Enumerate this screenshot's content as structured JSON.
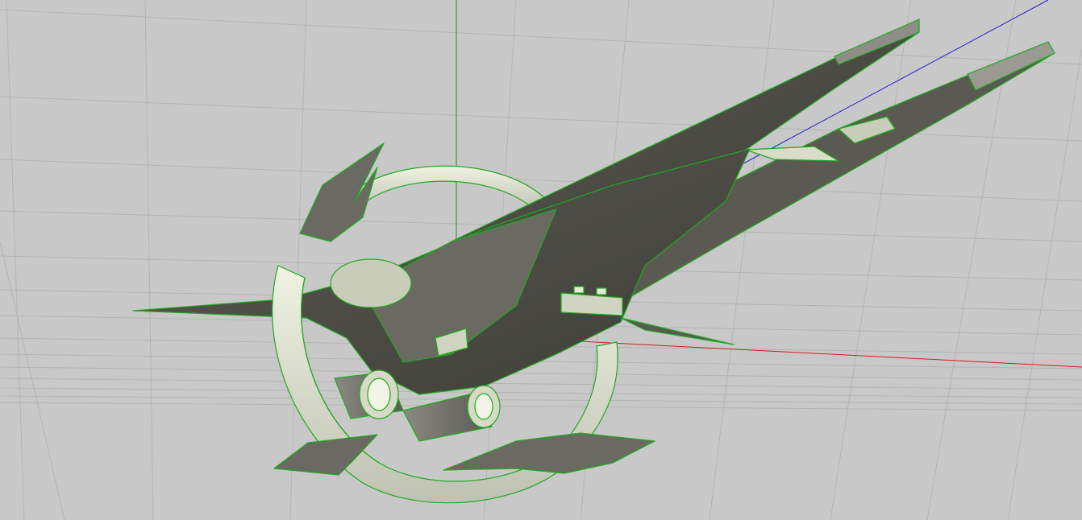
{
  "viewport": {
    "background": "#c8c8c8",
    "grid_color": "#b2b2b2",
    "axis_colors": {
      "x": "#cc2020",
      "y": "#1f8a1f",
      "z": "#2020d0"
    },
    "wire_color": "#1faa1f",
    "shade_dark": "#4a4a44",
    "shade_mid": "#6e6e66",
    "shade_light": "#e8ecd8"
  }
}
